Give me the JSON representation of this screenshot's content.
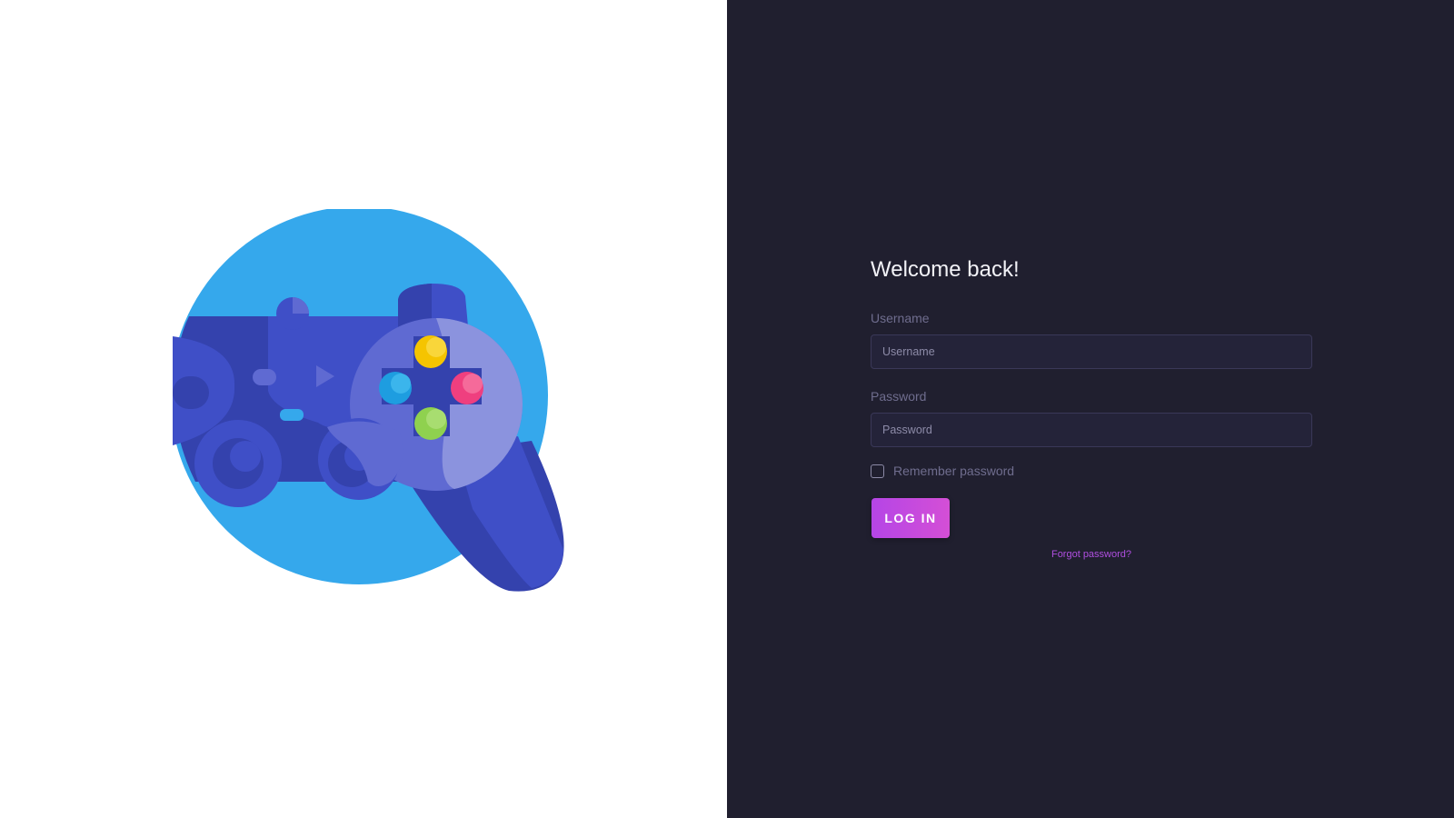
{
  "illustration": {
    "icon": "gamepad-icon",
    "colors": {
      "circle": "#35a8ec",
      "controller_dark": "#3442ad",
      "controller_mid": "#3f4fc7",
      "controller_light": "#5f6ad2",
      "controller_pale": "#8b93de",
      "button_yellow": "#f5c400",
      "button_pink": "#ef3f7f",
      "button_blue": "#1e9de0",
      "button_green": "#8fd14f"
    }
  },
  "login": {
    "title": "Welcome back!",
    "username_label": "Username",
    "username_placeholder": "Username",
    "username_value": "",
    "password_label": "Password",
    "password_placeholder": "Password",
    "password_value": "",
    "remember_label": "Remember password",
    "remember_checked": false,
    "submit_label": "LOG IN",
    "forgot_label": "Forgot password?"
  },
  "colors": {
    "left_background": "#ffffff",
    "right_background": "#201f2f",
    "accent": "#c04be0",
    "label_text": "#6f6d8e",
    "input_background": "#242339"
  }
}
